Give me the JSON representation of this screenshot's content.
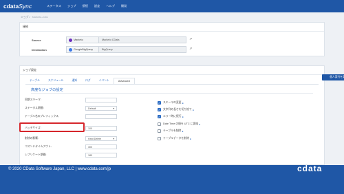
{
  "nav": {
    "brand_bold": "cdata",
    "brand_thin": "Sync",
    "items": [
      "ステータス",
      "ジョブ",
      "接続",
      "設定",
      "ヘルプ",
      "開発"
    ]
  },
  "breadcrumb": {
    "parent": "ジョブ",
    "current": "Marketo-Jobs"
  },
  "connections": {
    "title": "接続",
    "source_label": "Source",
    "source_name": "Marketo",
    "source_type": "Marketo CData",
    "dest_label": "Destination",
    "dest_name": "GoogleBigQuery",
    "dest_type": "BigQuery",
    "colors": {
      "source_logo": "#6b2fbf",
      "dest_logo": "#3b78e7"
    }
  },
  "job": {
    "title": "ジョブ設定",
    "tabs": [
      "テーブル",
      "スケジュール",
      "通知",
      "ログ",
      "イベント",
      "Advanced"
    ],
    "active_tab": "Advanced",
    "execute_button": "個人実行を実行",
    "section_title": "高度なジョブの設定",
    "fields": [
      {
        "label": "同期スキーマ:",
        "value": ""
      },
      {
        "label": "ステータス期間:",
        "value": "Default"
      },
      {
        "label": "テーブル名のプレフィックス:",
        "value": ""
      },
      {
        "label": "バッチサイズ:",
        "value": "100"
      },
      {
        "label": "削除の影響:",
        "value": "Hard Delete"
      },
      {
        "label": "コマンドタイムアウト:",
        "value": "300"
      },
      {
        "label": "レプリケート期間:",
        "value": "180"
      }
    ],
    "checkboxes": [
      {
        "label": "スキーマの変更",
        "checked": true
      },
      {
        "label": "文字列の長さを切り捨て",
        "checked": true
      },
      {
        "label": "エラー時に続行",
        "checked": true
      },
      {
        "label": "Date Time の値を UTC に変換",
        "checked": false
      },
      {
        "label": "テーブルを削除",
        "checked": false
      },
      {
        "label": "テーブルデータを削除",
        "checked": false
      }
    ]
  },
  "footer": {
    "copyright": "© 2020 CData Software Japan, LLC  |  www.cdata.com/jp",
    "logo": "cdata"
  },
  "colors": {
    "primary": "#1f57a6",
    "highlight": "#d6262b"
  }
}
